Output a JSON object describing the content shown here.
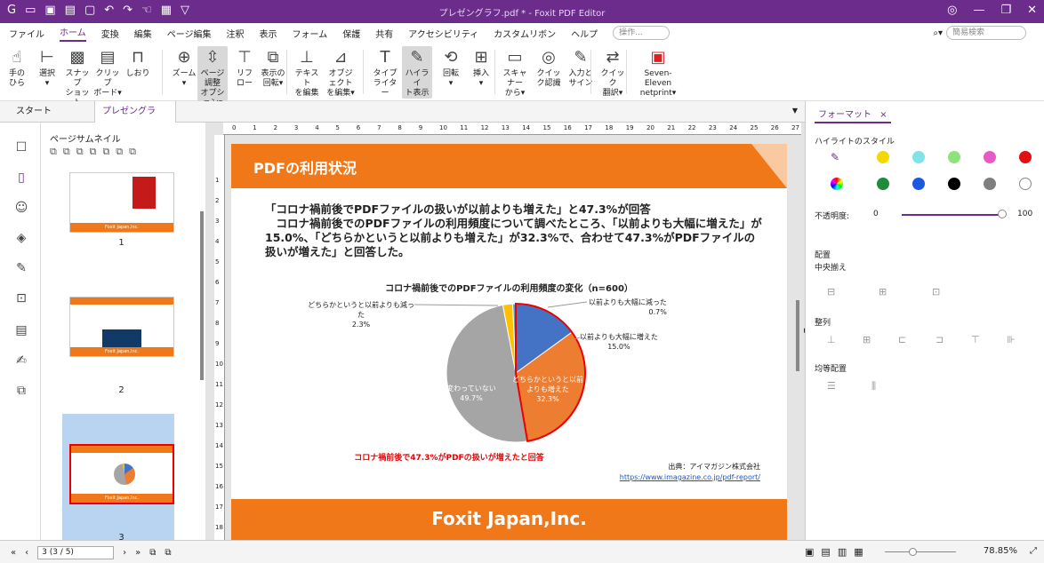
{
  "window": {
    "title": "プレゼングラフ.pdf * - Foxit PDF Editor"
  },
  "menu": [
    "ファイル",
    "ホーム",
    "変換",
    "編集",
    "ページ編集",
    "注釈",
    "表示",
    "フォーム",
    "保護",
    "共有",
    "アクセシビリティ",
    "カスタムリボン",
    "ヘルプ"
  ],
  "menu_active": "ホーム",
  "menu_search_placeholder": "操作...",
  "top_search": "簡易検索",
  "ribbon": [
    {
      "l1": "手の",
      "l2": "ひら",
      "icon": "hand-icon"
    },
    {
      "l1": "選択",
      "l2": "▾",
      "icon": "select-icon"
    },
    {
      "l1": "スナップ",
      "l2": "ショット",
      "icon": "snapshot-icon"
    },
    {
      "l1": "クリップ",
      "l2": "ボード▾",
      "icon": "clipboard-icon"
    },
    {
      "l1": "しおり",
      "l2": "",
      "icon": "bookmark-icon"
    },
    {
      "l1": "ズーム",
      "l2": "▾",
      "icon": "zoom-icon"
    },
    {
      "l1": "ページ調整",
      "l2": "オプション▾",
      "icon": "fit-icon"
    },
    {
      "l1": "リフ",
      "l2": "ロー",
      "icon": "reflow-icon"
    },
    {
      "l1": "表示の",
      "l2": "回転▾",
      "icon": "rotate-view-icon"
    },
    {
      "l1": "テキスト",
      "l2": "を編集",
      "icon": "edit-text-icon"
    },
    {
      "l1": "オブジェクト",
      "l2": "を編集▾",
      "icon": "edit-object-icon"
    },
    {
      "l1": "タイプ",
      "l2": "ライター",
      "icon": "typewriter-icon"
    },
    {
      "l1": "ハイライ",
      "l2": "ト表示",
      "icon": "highlight-icon"
    },
    {
      "l1": "回転",
      "l2": "▾",
      "icon": "rotate-icon"
    },
    {
      "l1": "挿入",
      "l2": "▾",
      "icon": "insert-icon"
    },
    {
      "l1": "スキャナー",
      "l2": "から▾",
      "icon": "scanner-icon"
    },
    {
      "l1": "クイッ",
      "l2": "ク認識",
      "icon": "ocr-icon"
    },
    {
      "l1": "入力と",
      "l2": "サイン",
      "icon": "sign-icon"
    },
    {
      "l1": "クイック",
      "l2": "翻訳▾",
      "icon": "translate-icon"
    },
    {
      "l1": "Seven-Eleven",
      "l2": "netprint▾",
      "icon": "netprint-icon"
    }
  ],
  "tabs": {
    "start": "スタート",
    "doc": "プレゼングラフ.p...",
    "close": "×"
  },
  "thumbs": {
    "header": "ページサムネイル",
    "nums": [
      "1",
      "2",
      "3"
    ],
    "footer": "Foxit Japan,Inc."
  },
  "slide": {
    "title": "PDFの利用状況",
    "headline": "「コロナ禍前後でPDFファイルの扱いが以前よりも増えた」と47.3%が回答",
    "body": "　コロナ禍前後でのPDFファイルの利用頻度について調べたところ、「以前よりも大幅に増えた」が15.0%、「どちらかというと以前よりも増えた」が32.3%で、合わせて47.3%がPDFファイルの扱いが増えた」と回答した。",
    "footer": "Foxit Japan,Inc.",
    "conclusion": "コロナ禍前後で47.3%がPDFの扱いが増えたと回答",
    "source": "出典：アイマガジン株式会社",
    "source_url": "https://www.imagazine.co.jp/pdf-report/"
  },
  "chart_data": {
    "type": "pie",
    "title": "コロナ禍前後でのPDFファイルの利用頻度の変化（n=600）",
    "labels": [
      "以前よりも大幅に増えた",
      "どちらかというと以前よりも増えた",
      "変わっていない",
      "どちらかというと以前よりも減った",
      "以前よりも大幅に減った"
    ],
    "values": [
      15.0,
      32.3,
      49.7,
      2.3,
      0.7
    ],
    "value_labels": [
      "15.0%",
      "32.3%",
      "49.7%",
      "2.3%",
      "0.7%"
    ],
    "colors": [
      "#4472c4",
      "#ed7d31",
      "#a5a5a5",
      "#ffc000",
      "#5b9bd5"
    ]
  },
  "right_panel": {
    "tab": "フォーマット",
    "highlight_style": "ハイライトのスタイル",
    "opacity_label": "不透明度:",
    "opacity_min": "0",
    "opacity_max": "100",
    "arrange": "配置",
    "center": "中央揃え",
    "align": "整列",
    "distribute": "均等配置",
    "colors": [
      "#f5d800",
      "#7fe3e8",
      "#8ee27a",
      "#e85ac8",
      "#e01010",
      "#1e8c3a",
      "#1a5ae0",
      "#000000",
      "#7f7f7f",
      "#ffffff"
    ]
  },
  "status": {
    "page": "3 (3 / 5)",
    "zoom": "78.85%"
  }
}
